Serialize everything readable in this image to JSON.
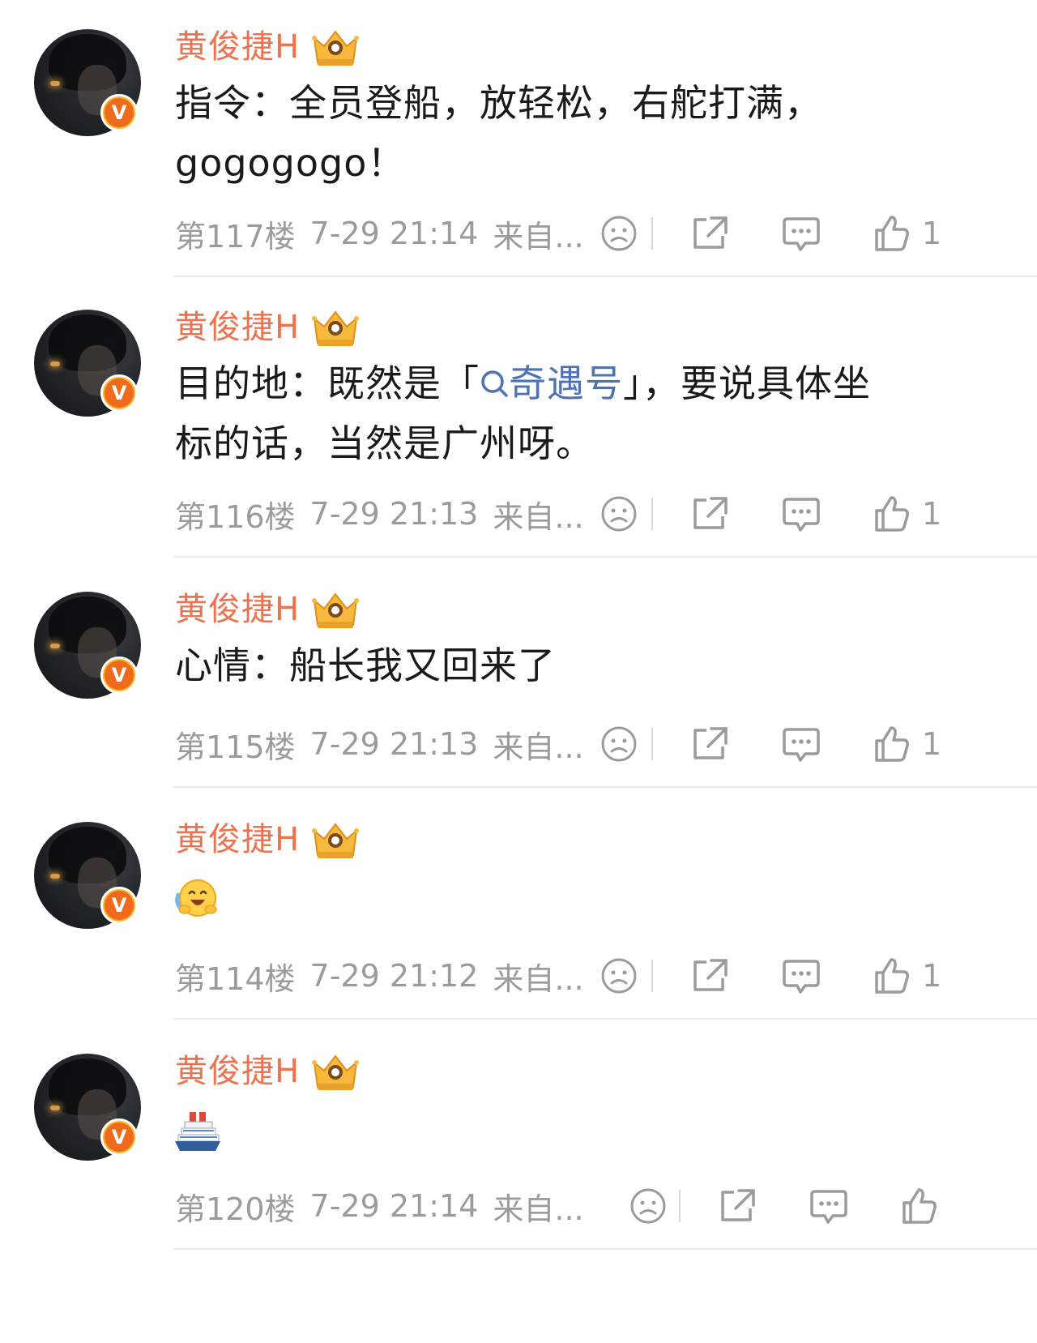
{
  "comments": [
    {
      "name": "黄俊捷H",
      "text_lines": [
        "指令：全员登船，放轻松，右舵打满，",
        "gogogogo！"
      ],
      "floor": "第117楼",
      "time": "7-29 21:14",
      "source": "来自...",
      "likes": "1"
    },
    {
      "name": "黄俊捷H",
      "text_before": "目的地：既然是「",
      "topic": "奇遇号",
      "text_after": "」，要说具体坐",
      "text_line2": "标的话，当然是广州呀。",
      "floor": "第116楼",
      "time": "7-29 21:13",
      "source": "来自...",
      "likes": "1"
    },
    {
      "name": "黄俊捷H",
      "text_lines": [
        "心情：船长我又回来了"
      ],
      "floor": "第115楼",
      "time": "7-29 21:13",
      "source": "来自...",
      "likes": "1"
    },
    {
      "name": "黄俊捷H",
      "emoji": "hug-laugh-emoji",
      "floor": "第114楼",
      "time": "7-29 21:12",
      "source": "来自...",
      "likes": "1"
    },
    {
      "name": "黄俊捷H",
      "emoji": "cruise-ship-emoji",
      "floor": "第120楼",
      "time": "7-29 21:14",
      "source": "来自...",
      "likes": ""
    }
  ],
  "badge_letter": "V",
  "colors": {
    "name": "#eb7350",
    "topic": "#4d73b3",
    "meta": "#9b9b9b"
  }
}
